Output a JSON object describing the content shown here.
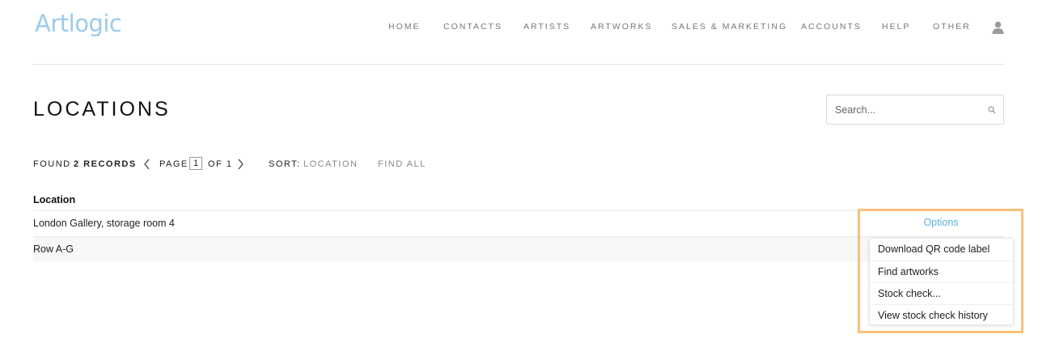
{
  "app": {
    "logo_text": "Artlogic",
    "brand_color": "#9ccbea",
    "accent_color": "#5aaedb",
    "highlight_color": "#f7c17a"
  },
  "nav": {
    "items": [
      {
        "label": "HOME"
      },
      {
        "label": "CONTACTS"
      },
      {
        "label": "ARTISTS"
      },
      {
        "label": "ARTWORKS"
      },
      {
        "label": "SALES & MARKETING"
      },
      {
        "label": "ACCOUNTS"
      },
      {
        "label": "HELP"
      },
      {
        "label": "OTHER"
      }
    ],
    "user_icon": "user-icon"
  },
  "page": {
    "title": "LOCATIONS"
  },
  "search": {
    "placeholder": "Search...",
    "value": "",
    "icon": "search-icon"
  },
  "toolbar": {
    "found_prefix": "FOUND",
    "record_count": "2 RECORDS",
    "page_label": "PAGE",
    "current_page": "1",
    "of_label": "OF 1",
    "sort_label": "SORT:",
    "sort_value": "LOCATION",
    "find_all": "FIND ALL"
  },
  "table": {
    "columns": [
      "Location"
    ],
    "rows": [
      {
        "location": "London Gallery, storage room 4"
      },
      {
        "location": "Row A-G"
      }
    ]
  },
  "options_menu": {
    "trigger_label": "Options",
    "items": [
      {
        "label": "Download QR code label"
      },
      {
        "label": "Find artworks"
      },
      {
        "label": "Stock check..."
      },
      {
        "label": "View stock check history"
      }
    ]
  }
}
